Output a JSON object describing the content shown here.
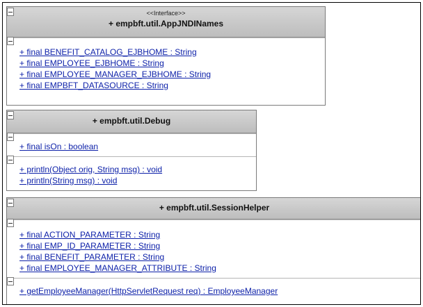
{
  "classes": [
    {
      "stereotype": "<<Interface>>",
      "name": "+ empbft.util.AppJNDINames",
      "attributes": [
        "+ final BENEFIT_CATALOG_EJBHOME : String",
        "+ final EMPLOYEE_EJBHOME : String",
        "+ final EMPLOYEE_MANAGER_EJBHOME : String",
        "+ final EMPBFT_DATASOURCE : String"
      ],
      "operations": []
    },
    {
      "stereotype": "",
      "name": "+ empbft.util.Debug",
      "attributes": [
        "+ final isOn : boolean"
      ],
      "operations": [
        "+ println(Object orig, String msg) : void",
        "+ println(String msg) : void"
      ]
    },
    {
      "stereotype": "",
      "name": "+ empbft.util.SessionHelper",
      "attributes": [
        "+ final ACTION_PARAMETER : String",
        "+ final EMP_ID_PARAMETER : String",
        "+ final BENEFIT_PARAMETER : String",
        "+ final EMPLOYEE_MANAGER_ATTRIBUTE : String"
      ],
      "operations": [
        "+ getEmployeeManager(HttpServletRequest req) : EmployeeManager"
      ]
    }
  ]
}
